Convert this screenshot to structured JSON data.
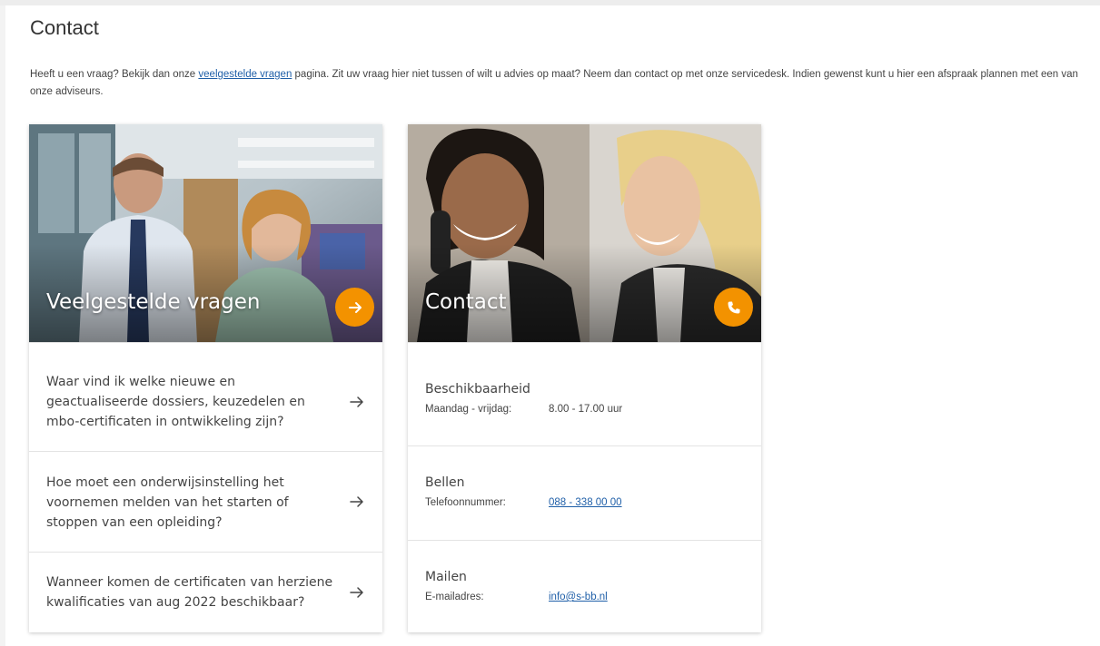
{
  "page": {
    "title": "Contact",
    "intro_before": "Heeft u een vraag? Bekijk dan onze ",
    "intro_link": "veelgestelde vragen",
    "intro_after": " pagina. Zit uw vraag hier niet tussen of wilt u advies op maat? Neem dan contact op met onze servicedesk. Indien gewenst kunt u hier een afspraak plannen met een van onze adviseurs."
  },
  "faq_card": {
    "title": "Veelgestelde vragen",
    "button_icon": "arrow-right-icon",
    "items": [
      {
        "question": "Waar vind ik welke nieuwe en geactualiseerde dossiers, keuzedelen en mbo-certificaten in ontwikkeling zijn?"
      },
      {
        "question": "Hoe moet een onderwijsinstelling het voornemen melden van het starten of stoppen van een opleiding?"
      },
      {
        "question": "Wanneer komen de certificaten van herziene kwalificaties van aug 2022 beschikbaar?"
      }
    ]
  },
  "contact_card": {
    "title": "Contact",
    "button_icon": "phone-icon",
    "availability": {
      "heading": "Beschikbaarheid",
      "label": "Maandag - vrijdag:",
      "value": "8.00 - 17.00 uur"
    },
    "phone": {
      "heading": "Bellen",
      "label": "Telefoonnummer:",
      "value": "088 - 338 00 00"
    },
    "email": {
      "heading": "Mailen",
      "label": "E-mailadres:",
      "value": "info@s-bb.nl"
    }
  },
  "colors": {
    "accent": "#f39200",
    "link": "#1f5fa8",
    "text": "#444444"
  }
}
